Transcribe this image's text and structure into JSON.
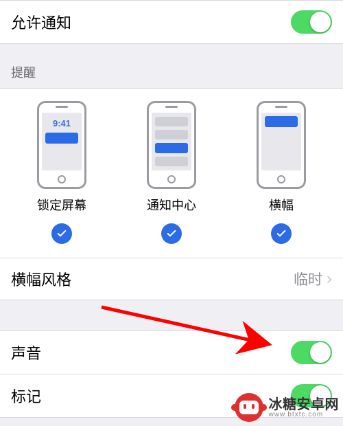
{
  "allow_notifications": {
    "label": "允许通知",
    "enabled": true
  },
  "alerts_header": "提醒",
  "alert_styles": {
    "lock_screen": {
      "label": "锁定屏幕",
      "checked": true,
      "time": "9:41"
    },
    "notification_center": {
      "label": "通知中心",
      "checked": true
    },
    "banners": {
      "label": "横幅",
      "checked": true
    }
  },
  "banner_style": {
    "label": "横幅风格",
    "value": "临时"
  },
  "sounds": {
    "label": "声音",
    "enabled": true
  },
  "badges": {
    "label": "标记",
    "enabled": true
  },
  "colors": {
    "switch_on": "#4cd964",
    "accent_blue": "#2b6be6",
    "arrow_red": "#ff0000",
    "brand_red": "#e02f2f"
  },
  "watermark": {
    "name": "冰糖安卓网",
    "domain": "www.btxtc.com"
  }
}
